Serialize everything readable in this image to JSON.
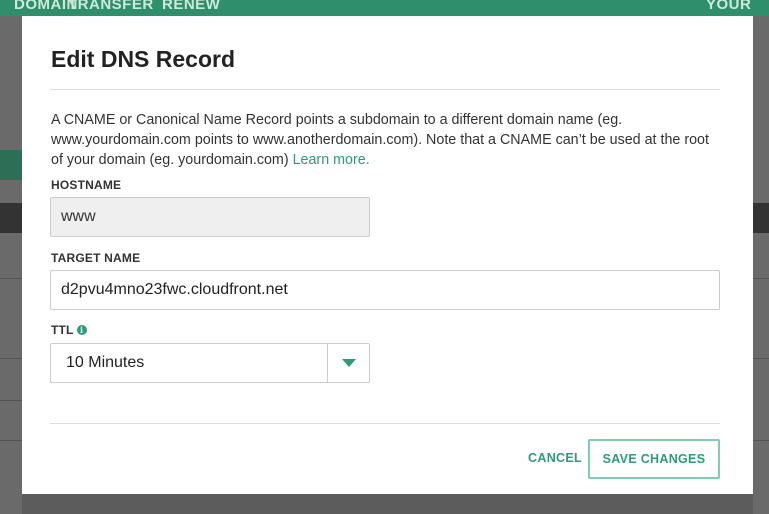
{
  "modal": {
    "title": "Edit DNS Record",
    "description": "A CNAME or Canonical Name Record points a subdomain to a different domain name (eg. www.yourdomain.com points to www.anotherdomain.com). Note that a CNAME can’t be used at the root of your domain (eg. yourdomain.com) ",
    "learn_more": "Learn more.",
    "hostname": {
      "label": "HOSTNAME",
      "value": "www"
    },
    "target": {
      "label": "TARGET NAME",
      "value": "d2pvu4mno23fwc.cloudfront.net"
    },
    "ttl": {
      "label": "TTL",
      "info_icon": "info-icon",
      "value": "10 Minutes",
      "caret_icon": "chevron-down-icon"
    },
    "buttons": {
      "cancel": "CANCEL",
      "save": "SAVE CHANGES"
    }
  },
  "background": {
    "nav": [
      "DOMAIN",
      "TRANSFER",
      "RENEW",
      "YOUR AC"
    ]
  },
  "colors": {
    "accent": "#2a9d74",
    "overlay": "#5c5c5c"
  }
}
